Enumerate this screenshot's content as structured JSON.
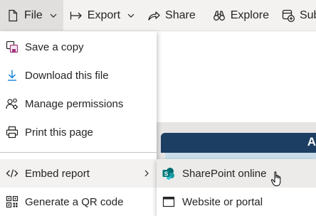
{
  "toolbar": {
    "file": "File",
    "export": "Export",
    "share": "Share",
    "explore": "Explore",
    "subscribe": "Subs"
  },
  "file_menu": {
    "items": [
      {
        "label": "Save a copy",
        "icon": "save-copy-icon"
      },
      {
        "label": "Download this file",
        "icon": "download-icon"
      },
      {
        "label": "Manage permissions",
        "icon": "people-settings-icon"
      },
      {
        "label": "Print this page",
        "icon": "printer-icon"
      },
      {
        "label": "Embed report",
        "icon": "code-icon"
      },
      {
        "label": "Generate a QR code",
        "icon": "qr-code-icon"
      }
    ]
  },
  "embed_submenu": {
    "items": [
      {
        "label": "SharePoint online",
        "icon": "sharepoint-icon"
      },
      {
        "label": "Website or portal",
        "icon": "website-icon"
      }
    ]
  },
  "report": {
    "header_letter": "A"
  },
  "colors": {
    "sharepoint": "#038387",
    "report_header": "#1b3e62"
  }
}
